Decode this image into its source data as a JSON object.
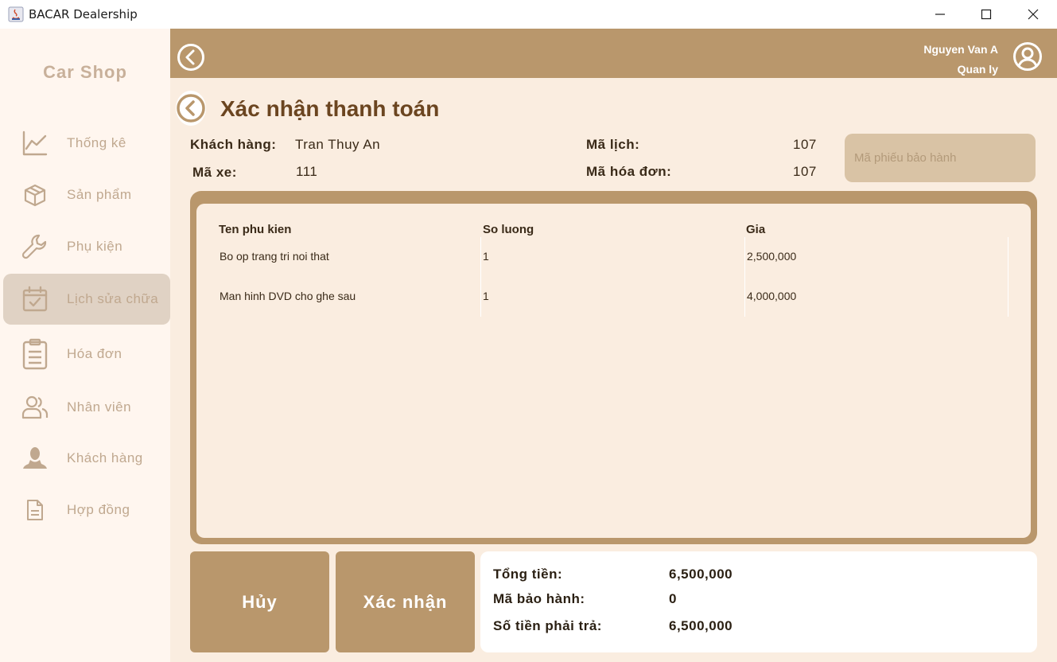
{
  "window": {
    "title": "BACAR Dealership"
  },
  "sidebar": {
    "brand": "Car Shop",
    "items": [
      {
        "label": "Thống kê",
        "icon": "chart-line-icon",
        "active": false
      },
      {
        "label": "Sản phẩm",
        "icon": "box-icon",
        "active": false
      },
      {
        "label": "Phụ kiện",
        "icon": "wrench-icon",
        "active": false
      },
      {
        "label": "Lịch sửa chữa",
        "icon": "calendar-check-icon",
        "active": true
      },
      {
        "label": "Hóa đơn",
        "icon": "clipboard-icon",
        "active": false
      },
      {
        "label": "Nhân viên",
        "icon": "users-icon",
        "active": false
      },
      {
        "label": "Khách hàng",
        "icon": "customer-icon",
        "active": false
      },
      {
        "label": "Hợp đồng",
        "icon": "document-icon",
        "active": false
      }
    ]
  },
  "header": {
    "user_name": "Nguyen Van A",
    "user_role": "Quan ly"
  },
  "page": {
    "title": "Xác nhận thanh toán",
    "customer_label": "Khách hàng:",
    "customer_value": "Tran Thuy An",
    "car_label": "Mã xe:",
    "car_value": "111",
    "schedule_label": "Mã lịch:",
    "schedule_value": "107",
    "invoice_label": "Mã hóa đơn:",
    "invoice_value": "107",
    "warranty_placeholder": "Mã phiếu bảo hành"
  },
  "table": {
    "headers": [
      "Ten phu kien",
      "So luong",
      "Gia"
    ],
    "rows": [
      [
        "Bo op trang tri noi that",
        "1",
        "2,500,000"
      ],
      [
        "Man hinh DVD cho ghe sau",
        "1",
        "4,000,000"
      ]
    ]
  },
  "actions": {
    "cancel_label": "Hủy",
    "confirm_label": "Xác nhận"
  },
  "summary": {
    "total_label": "Tổng tiền:",
    "total_value": "6,500,000",
    "warranty_label": "Mã bảo hành:",
    "warranty_value": "0",
    "pay_label": "Số tiền phải trả:",
    "pay_value": "6,500,000"
  },
  "colors": {
    "accent": "#b9976c",
    "background": "#faede0",
    "sidebar": "#fff6ef",
    "active_item": "#e0d2c4",
    "title_text": "#6b4520"
  }
}
